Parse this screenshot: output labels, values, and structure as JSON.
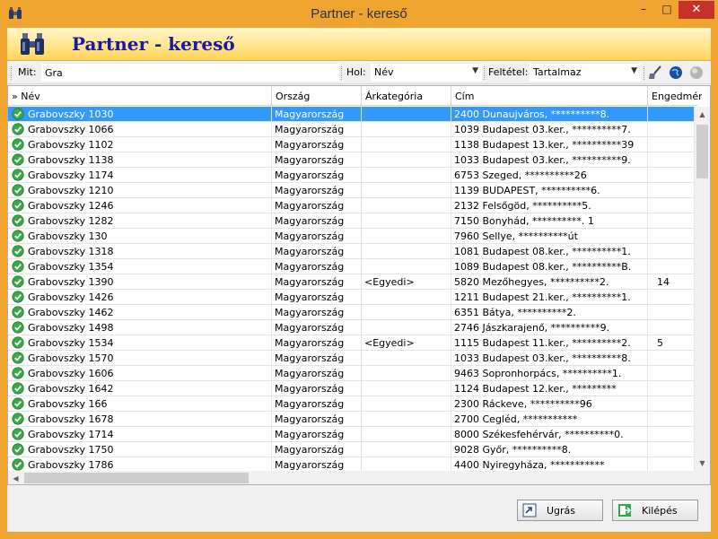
{
  "window": {
    "title": "Partner - kereső"
  },
  "header": {
    "title": "Partner - kereső"
  },
  "toolbar": {
    "search_label": "Mit:",
    "search_value": "Gra",
    "where_label": "Hol:",
    "where_value": "Név",
    "condition_label": "Feltétel:",
    "condition_value": "Tartalmaz"
  },
  "columns": {
    "sort_marker": "»",
    "name": "Név",
    "country": "Ország",
    "price_category": "Árkategória",
    "address": "Cím",
    "discount": "Engedmény"
  },
  "rows": [
    {
      "name": "Grabovszky  1030",
      "country": "Magyarország",
      "price_category": "",
      "address": "2400 Dunaujváros, **********8.",
      "discount": ""
    },
    {
      "name": "Grabovszky  1066",
      "country": "Magyarország",
      "price_category": "",
      "address": "1039 Budapest 03.ker., **********7.",
      "discount": ""
    },
    {
      "name": "Grabovszky  1102",
      "country": "Magyarország",
      "price_category": "",
      "address": "1138 Budapest 13.ker., **********39",
      "discount": ""
    },
    {
      "name": "Grabovszky  1138",
      "country": "Magyarország",
      "price_category": "",
      "address": "1033 Budapest 03.ker., **********9.",
      "discount": ""
    },
    {
      "name": "Grabovszky  1174",
      "country": "Magyarország",
      "price_category": "",
      "address": "6753 Szeged, **********26",
      "discount": ""
    },
    {
      "name": "Grabovszky  1210",
      "country": "Magyarország",
      "price_category": "",
      "address": "1139 BUDAPEST, **********6.",
      "discount": ""
    },
    {
      "name": "Grabovszky  1246",
      "country": "Magyarország",
      "price_category": "",
      "address": "2132 Felsőgöd, **********5.",
      "discount": ""
    },
    {
      "name": "Grabovszky  1282",
      "country": "Magyarország",
      "price_category": "",
      "address": "7150 Bonyhád, **********. 1",
      "discount": ""
    },
    {
      "name": "Grabovszky  130",
      "country": "Magyarország",
      "price_category": "",
      "address": "7960 Sellye, **********út",
      "discount": ""
    },
    {
      "name": "Grabovszky  1318",
      "country": "Magyarország",
      "price_category": "",
      "address": "1081 Budapest 08.ker., **********1.",
      "discount": ""
    },
    {
      "name": "Grabovszky  1354",
      "country": "Magyarország",
      "price_category": "",
      "address": "1089 Budapest 08.ker., **********B.",
      "discount": ""
    },
    {
      "name": "Grabovszky  1390",
      "country": "Magyarország",
      "price_category": "<Egyedi>",
      "address": "5820 Mezőhegyes, **********2.",
      "discount": "14"
    },
    {
      "name": "Grabovszky  1426",
      "country": "Magyarország",
      "price_category": "",
      "address": "1211 Budapest 21.ker., **********1.",
      "discount": ""
    },
    {
      "name": "Grabovszky  1462",
      "country": "Magyarország",
      "price_category": "",
      "address": "6351 Bátya, **********2.",
      "discount": ""
    },
    {
      "name": "Grabovszky  1498",
      "country": "Magyarország",
      "price_category": "",
      "address": "2746 Jászkarajenő, **********9.",
      "discount": ""
    },
    {
      "name": "Grabovszky  1534",
      "country": "Magyarország",
      "price_category": "<Egyedi>",
      "address": "1115 Budapest 11.ker., **********2.",
      "discount": "5"
    },
    {
      "name": "Grabovszky  1570",
      "country": "Magyarország",
      "price_category": "",
      "address": "1033 Budapest 03.ker., **********8.",
      "discount": ""
    },
    {
      "name": "Grabovszky  1606",
      "country": "Magyarország",
      "price_category": "",
      "address": "9463 Sopronhorpács, **********1.",
      "discount": ""
    },
    {
      "name": "Grabovszky  1642",
      "country": "Magyarország",
      "price_category": "",
      "address": "1124 Budapest 12.ker., *********",
      "discount": ""
    },
    {
      "name": "Grabovszky  166",
      "country": "Magyarország",
      "price_category": "",
      "address": "2300 Ráckeve, **********96",
      "discount": ""
    },
    {
      "name": "Grabovszky  1678",
      "country": "Magyarország",
      "price_category": "",
      "address": "2700 Cegléd, ***********",
      "discount": ""
    },
    {
      "name": "Grabovszky  1714",
      "country": "Magyarország",
      "price_category": "",
      "address": "8000 Székesfehérvár, **********0.",
      "discount": ""
    },
    {
      "name": "Grabovszky  1750",
      "country": "Magyarország",
      "price_category": "",
      "address": "9028 Győr, **********8.",
      "discount": ""
    },
    {
      "name": "Grabovszky  1786",
      "country": "Magyarország",
      "price_category": "",
      "address": "4400 Nyiregyháza, ***********",
      "discount": ""
    }
  ],
  "buttons": {
    "goto": "Ugrás",
    "exit": "Kilépés"
  },
  "colors": {
    "selected_row": "#3399ff",
    "header_title": "#1a1aa0",
    "window_frame": "#f0a430",
    "close_button": "#c7312b"
  }
}
